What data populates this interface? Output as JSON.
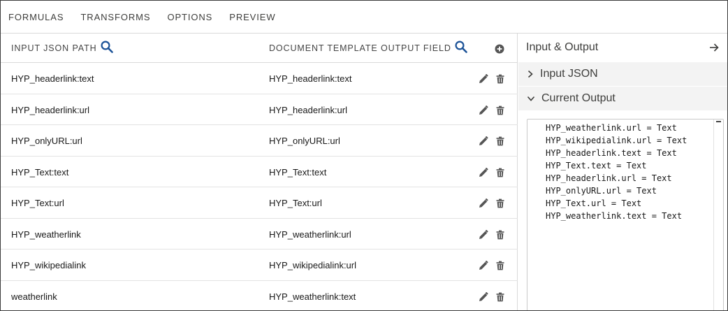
{
  "tabs": [
    {
      "label": "FORMULAS"
    },
    {
      "label": "TRANSFORMS"
    },
    {
      "label": "OPTIONS"
    },
    {
      "label": "PREVIEW"
    }
  ],
  "mapping": {
    "header": {
      "input_path": "INPUT JSON PATH",
      "output_field": "DOCUMENT TEMPLATE OUTPUT FIELD"
    },
    "rows": [
      {
        "input": "HYP_headerlink:text",
        "output": "HYP_headerlink:text"
      },
      {
        "input": "HYP_headerlink:url",
        "output": "HYP_headerlink:url"
      },
      {
        "input": "HYP_onlyURL:url",
        "output": "HYP_onlyURL:url"
      },
      {
        "input": "HYP_Text:text",
        "output": "HYP_Text:text"
      },
      {
        "input": "HYP_Text:url",
        "output": "HYP_Text:url"
      },
      {
        "input": "HYP_weatherlink",
        "output": "HYP_weatherlink:url"
      },
      {
        "input": "HYP_wikipedialink",
        "output": "HYP_wikipedialink:url"
      },
      {
        "input": "weatherlink",
        "output": "HYP_weatherlink:text"
      }
    ]
  },
  "panel": {
    "title": "Input & Output",
    "input_json_label": "Input JSON",
    "current_output_label": "Current Output",
    "output_lines": [
      "HYP_weatherlink.url = Text",
      "HYP_wikipedialink.url = Text",
      "HYP_headerlink.text = Text",
      "HYP_Text.text = Text",
      "HYP_headerlink.url = Text",
      "HYP_onlyURL.url = Text",
      "HYP_Text.url = Text",
      "HYP_weatherlink.text = Text"
    ]
  },
  "colors": {
    "accent_blue": "#1b5297",
    "icon_gray": "#555555",
    "accordion_bg": "#f3f3f3"
  }
}
